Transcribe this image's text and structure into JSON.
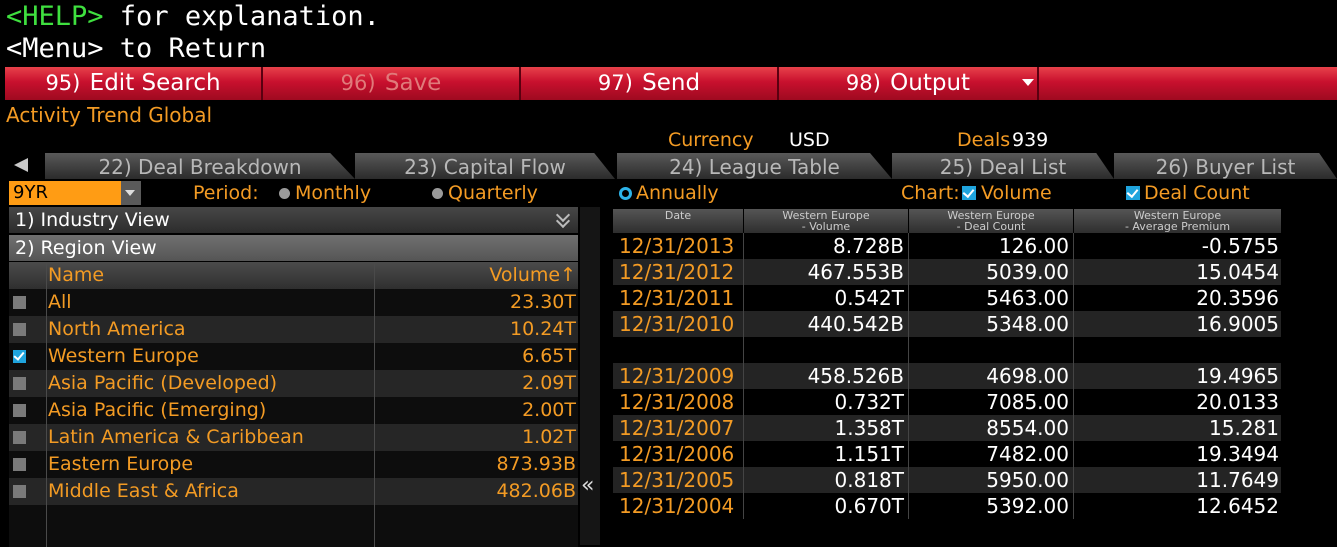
{
  "command_lines": {
    "help_key": "<HELP>",
    "help_rest": " for explanation.",
    "menu": "<Menu> to Return"
  },
  "toolbar": {
    "buttons": [
      {
        "num": "95)",
        "label": "Edit Search"
      },
      {
        "num": "96)",
        "label": "Save"
      },
      {
        "num": "97)",
        "label": "Send"
      },
      {
        "num": "98)",
        "label": "Output"
      }
    ]
  },
  "screen_title": "Activity Trend Global",
  "summary": {
    "currency_label": "Currency",
    "currency_value": "USD",
    "deals_label": "Deals",
    "deals_value": "939"
  },
  "tabs": [
    "22) Deal Breakdown",
    "23) Capital Flow",
    "24) League Table",
    "25) Deal List",
    "26) Buyer List"
  ],
  "controls": {
    "range_value": "9YR",
    "period_label": "Period:",
    "period_options": [
      "Monthly",
      "Quarterly",
      "Annually"
    ],
    "period_selected": "Annually",
    "chart_label": "Chart:",
    "chart_volume": "Volume",
    "chart_deal_count": "Deal Count"
  },
  "left_panel": {
    "industry_view": "1) Industry View",
    "region_view": "2) Region View",
    "columns": {
      "name": "Name",
      "volume": "Volume↑"
    },
    "rows": [
      {
        "name": "All",
        "volume": "23.30T",
        "checked": false
      },
      {
        "name": "North America",
        "volume": "10.24T",
        "checked": false
      },
      {
        "name": "Western Europe",
        "volume": "6.65T",
        "checked": true
      },
      {
        "name": "Asia Pacific (Developed)",
        "volume": "2.09T",
        "checked": false
      },
      {
        "name": "Asia Pacific (Emerging)",
        "volume": "2.00T",
        "checked": false
      },
      {
        "name": "Latin America & Caribbean",
        "volume": "1.02T",
        "checked": false
      },
      {
        "name": "Eastern Europe",
        "volume": "873.93B",
        "checked": false
      },
      {
        "name": "Middle East & Africa",
        "volume": "482.06B",
        "checked": false
      }
    ]
  },
  "collapse_glyph": "«",
  "right_table": {
    "headers": [
      [
        "Date"
      ],
      [
        "Western Europe",
        "- Volume"
      ],
      [
        "Western Europe",
        "- Deal Count"
      ],
      [
        "Western Europe",
        "- Average Premium"
      ]
    ],
    "rows": [
      [
        "12/31/2013",
        "8.728B",
        "126.00",
        "-0.5755"
      ],
      [
        "12/31/2012",
        "467.553B",
        "5039.00",
        "15.0454"
      ],
      [
        "12/31/2011",
        "0.542T",
        "5463.00",
        "20.3596"
      ],
      [
        "12/31/2010",
        "440.542B",
        "5348.00",
        "16.9005"
      ],
      [
        "",
        "",
        "",
        ""
      ],
      [
        "12/31/2009",
        "458.526B",
        "4698.00",
        "19.4965"
      ],
      [
        "12/31/2008",
        "0.732T",
        "7085.00",
        "20.0133"
      ],
      [
        "12/31/2007",
        "1.358T",
        "8554.00",
        "15.281"
      ],
      [
        "12/31/2006",
        "1.151T",
        "7482.00",
        "19.3494"
      ],
      [
        "12/31/2005",
        "0.818T",
        "5950.00",
        "11.7649"
      ],
      [
        "12/31/2004",
        "0.670T",
        "5392.00",
        "12.6452"
      ]
    ]
  }
}
